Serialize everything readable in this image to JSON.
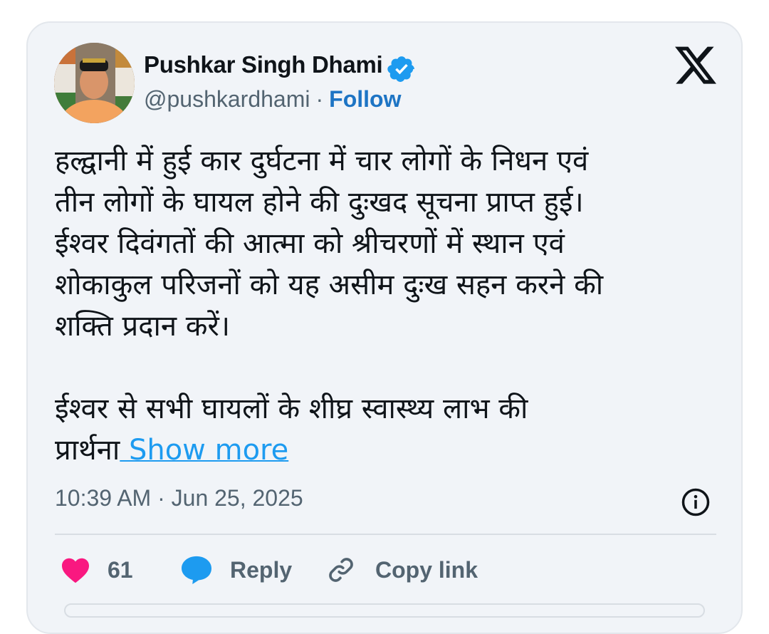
{
  "author": {
    "name": "Pushkar Singh Dhami",
    "handle": "@pushkardhami",
    "separator": "·",
    "follow_label": "Follow",
    "verified_icon": "verified-badge-icon",
    "avatar_icon": "profile-avatar"
  },
  "brand": {
    "logo_icon": "x-logo-icon"
  },
  "tweet": {
    "paragraph1": "हल्द्वानी में हुई कार दुर्घटना में चार लोगों के निधन एवं\nतीन लोगों के घायल होने की दुःखद सूचना प्राप्त हुई।\nईश्वर दिवंगतों की आत्मा को श्रीचरणों में स्थान एवं\nशोकाकुल परिजनों को यह असीम दुःख सहन करने की\nशक्ति प्रदान करें।",
    "paragraph2": "ईश्वर से सभी घायलों के शीघ्र स्वास्थ्य लाभ की\nप्रार्थना",
    "show_more_label": " Show more",
    "timestamp": "10:39 AM · Jun 25, 2025"
  },
  "actions": {
    "like_count": "61",
    "reply_label": "Reply",
    "copy_link_label": "Copy link"
  },
  "colors": {
    "card_bg": "#f1f4f8",
    "link_blue": "#1d9bf0",
    "follow_blue": "#1d74c4",
    "heart_pink": "#f91880",
    "reply_blue": "#1d9bf0",
    "muted_gray": "#536471"
  }
}
